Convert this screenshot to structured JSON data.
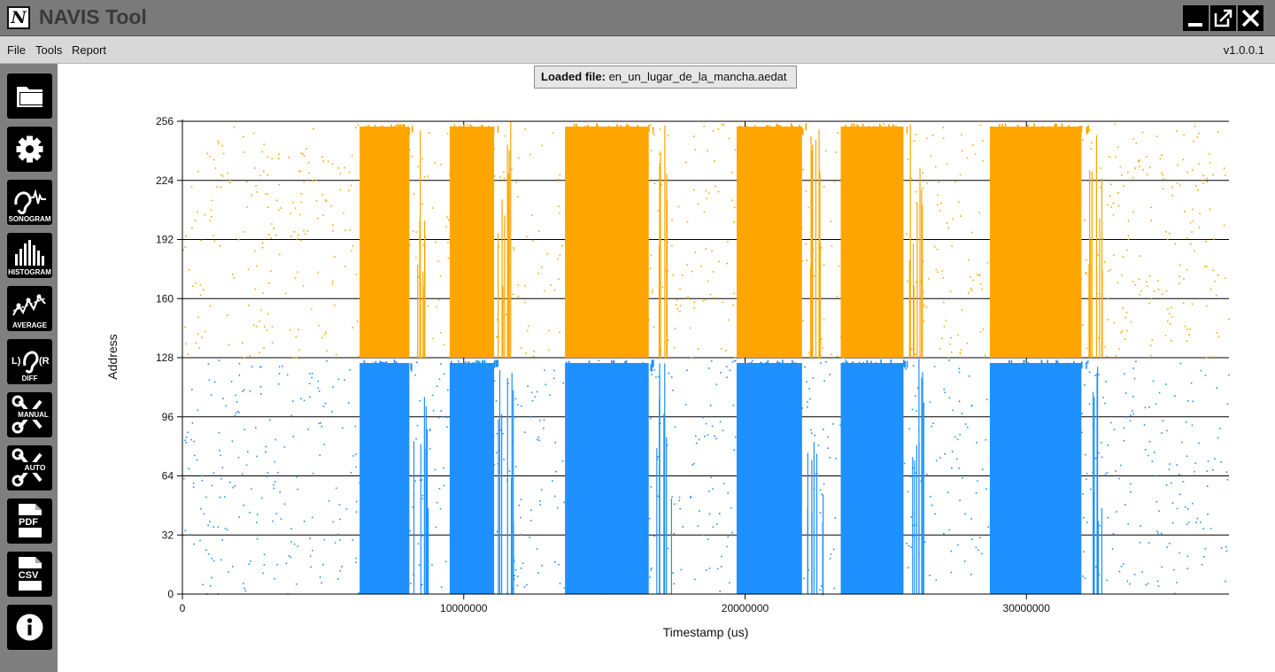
{
  "window": {
    "logo_letter": "N",
    "title": "NAVIS Tool",
    "controls": [
      "minimize",
      "maximize",
      "close"
    ]
  },
  "menu": {
    "items": [
      "File",
      "Tools",
      "Report"
    ],
    "version": "v1.0.0.1"
  },
  "sidebar": {
    "buttons": [
      {
        "icon": "folder-icon",
        "label": ""
      },
      {
        "icon": "gear-icon",
        "label": ""
      },
      {
        "icon": "sonogram-icon",
        "label": "SONOGRAM"
      },
      {
        "icon": "histogram-icon",
        "label": "HISTOGRAM"
      },
      {
        "icon": "average-icon",
        "label": "AVERAGE"
      },
      {
        "icon": "diff-icon",
        "label": "DIFF"
      },
      {
        "icon": "manual-cut-icon",
        "label": "MANUAL"
      },
      {
        "icon": "auto-cut-icon",
        "label": "AUTO"
      },
      {
        "icon": "pdf-icon",
        "label": "PDF"
      },
      {
        "icon": "csv-icon",
        "label": "CSV"
      },
      {
        "icon": "info-icon",
        "label": ""
      }
    ]
  },
  "loaded": {
    "label": "Loaded file:",
    "filename": "en_un_lugar_de_la_mancha.aedat"
  },
  "colors": {
    "titlebar": "#7a7a7a",
    "sidebar": "#7f7f7f",
    "left_channel": "#FFA500",
    "right_channel": "#1E90FF"
  },
  "chart_data": {
    "type": "scatter",
    "xlabel": "Timestamp (us)",
    "ylabel": "Address",
    "xlim": [
      0,
      37200000
    ],
    "ylim": [
      0,
      256
    ],
    "x_ticks": [
      "0",
      "10000000",
      "20000000",
      "30000000"
    ],
    "x_tick_values": [
      0,
      10000000,
      20000000,
      30000000
    ],
    "y_ticks": [
      "0",
      "32",
      "64",
      "96",
      "128",
      "160",
      "192",
      "224",
      "256"
    ],
    "y_tick_values": [
      0,
      32,
      64,
      96,
      128,
      160,
      192,
      224,
      256
    ],
    "grid": true,
    "series": [
      {
        "color": "#FFA500",
        "address_range": [
          128,
          255
        ],
        "dense_bursts_us": [
          [
            6300000,
            8200000
          ],
          [
            9500000,
            11200000
          ],
          [
            13600000,
            16800000
          ],
          [
            19700000,
            22200000
          ],
          [
            23400000,
            25800000
          ],
          [
            28700000,
            32200000
          ]
        ]
      },
      {
        "color": "#1E90FF",
        "address_range": [
          0,
          127
        ],
        "dense_bursts_us": [
          [
            6300000,
            8200000
          ],
          [
            9500000,
            11200000
          ],
          [
            13600000,
            16800000
          ],
          [
            19700000,
            22200000
          ],
          [
            23400000,
            25800000
          ],
          [
            28700000,
            32200000
          ]
        ]
      }
    ]
  }
}
